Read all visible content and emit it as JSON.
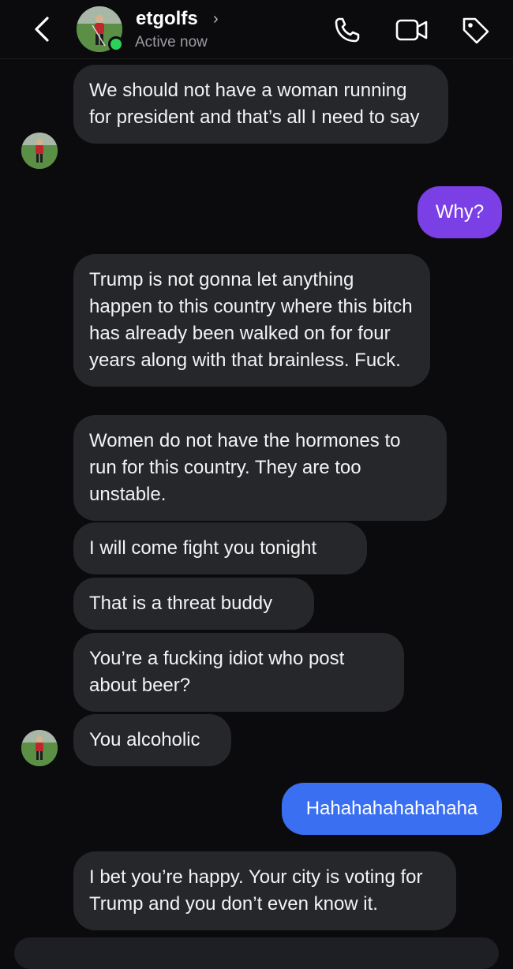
{
  "header": {
    "username": "etgolfs",
    "chevron": "›",
    "status": "Active now",
    "icons": [
      "chevron-left-icon",
      "phone-icon",
      "video-camera-icon",
      "tag-icon"
    ]
  },
  "colors": {
    "background": "#0b0b0e",
    "incoming_bubble": "#26272b",
    "outgoing_purple": "#7b3fe6",
    "outgoing_blue": "#3b6ff2",
    "online": "#2bd158"
  },
  "messages": [
    {
      "dir": "in",
      "text": "We should not have a woman running for president and that’s all I need to say"
    },
    {
      "dir": "out",
      "text": "Why?"
    },
    {
      "dir": "in",
      "text": "Trump is not gonna let anything happen to this country where this bitch has already been walked on for four years along with that brainless. Fuck."
    },
    {
      "dir": "in",
      "text": "Women do not have the hormones to run for this country. They are too unstable."
    },
    {
      "dir": "in",
      "text": "I will come fight you tonight"
    },
    {
      "dir": "in",
      "text": "That is a threat buddy"
    },
    {
      "dir": "in",
      "text": "You’re a fucking idiot who post about beer?"
    },
    {
      "dir": "in",
      "text": "You alcoholic"
    },
    {
      "dir": "out",
      "text": "Hahahahahahahaha"
    },
    {
      "dir": "in",
      "text": "I bet you’re happy. Your city is voting for Trump and you don’t even know it."
    }
  ]
}
